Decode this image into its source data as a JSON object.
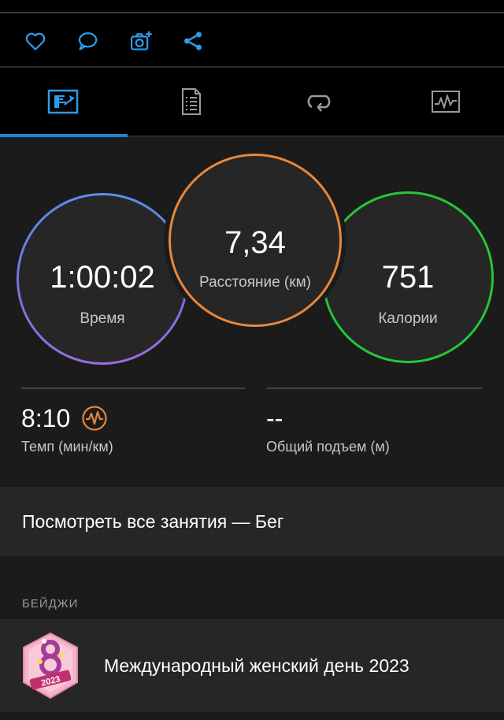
{
  "colors": {
    "accent": "#1b84d4",
    "time_ring": "#7d6fe0",
    "distance_ring": "#e8873a",
    "calories_ring": "#25c63a",
    "pace_icon": "#e8873a"
  },
  "actions": {
    "icons": [
      "heart-icon",
      "comment-icon",
      "add-photo-icon",
      "share-icon"
    ]
  },
  "tabs": {
    "items": [
      "stats-tab",
      "details-tab",
      "laps-tab",
      "charts-tab"
    ],
    "selected_index": 0
  },
  "stats": {
    "time": {
      "value": "1:00:02",
      "label": "Время"
    },
    "distance": {
      "value": "7,34",
      "label": "Расстояние (км)"
    },
    "calories": {
      "value": "751",
      "label": "Калории"
    },
    "pace": {
      "value": "8:10",
      "label": "Темп (мин/км)"
    },
    "ascent": {
      "value": "--",
      "label": "Общий подъем (м)"
    }
  },
  "all_activities": {
    "label": "Посмотреть все занятия — Бег"
  },
  "badges": {
    "section_title": "БЕЙДЖИ",
    "items": [
      {
        "name": "Международный женский день 2023",
        "badge_year": "2023",
        "badge_number": "8"
      }
    ]
  }
}
